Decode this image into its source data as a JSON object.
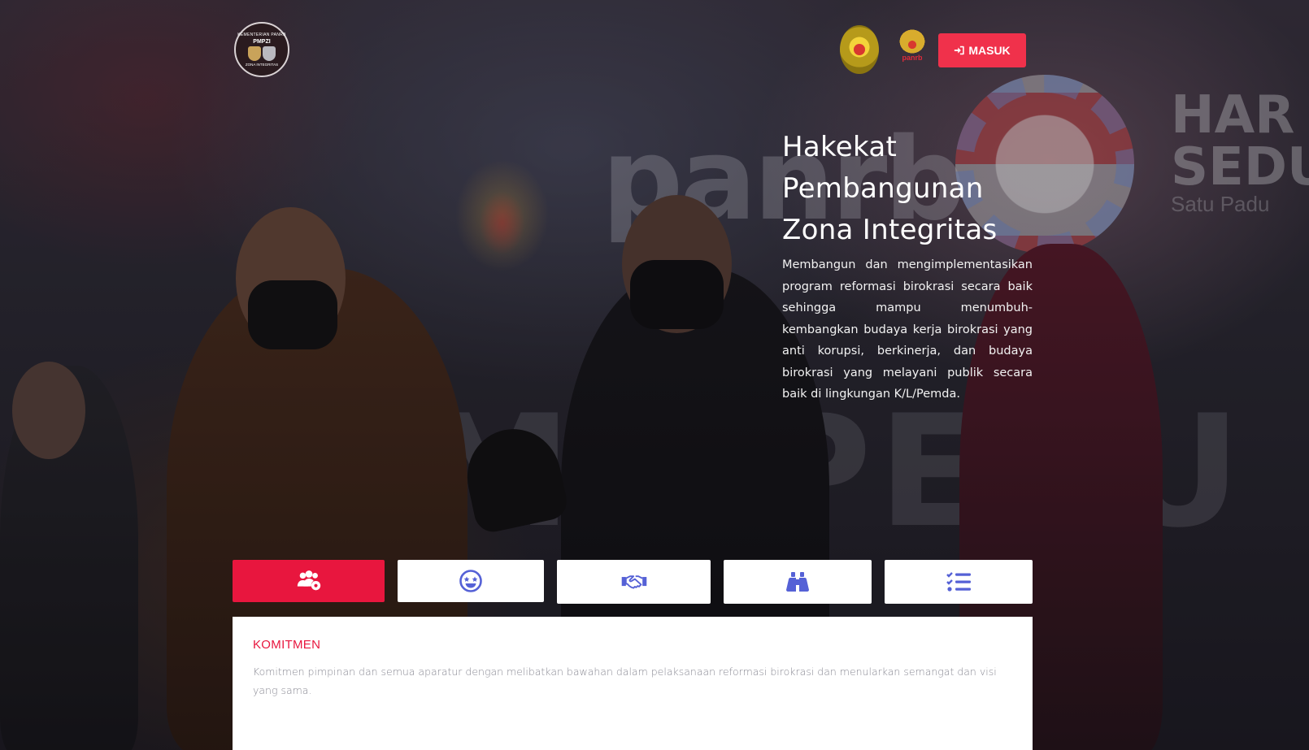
{
  "header": {
    "logo_left": {
      "top_text": "KEMENTERIAN PANRB",
      "mid_text": "PMPZI",
      "bottom_text": "ZONA INTEGRITAS"
    },
    "logo_panrb": {
      "word": "panrb"
    },
    "login_button": {
      "label": "MASUK",
      "icon": "sign-in-icon"
    }
  },
  "hero": {
    "title_line1": "Hakekat",
    "title_line2": "Pembangunan",
    "title_line3": "Zona Integritas",
    "description": "Membangun dan mengimplementasikan program reformasi birokrasi secara baik sehingga mampu menumbuh-kembangkan budaya kerja birokrasi yang anti korupsi, berkinerja, dan budaya birokrasi yang melayani publik secara baik di lingkungan K/L/Pemda."
  },
  "tabs": [
    {
      "icon": "users-cog-icon",
      "active": true
    },
    {
      "icon": "grin-stars-icon",
      "active": false
    },
    {
      "icon": "handshake-icon",
      "active": false
    },
    {
      "icon": "binoculars-icon",
      "active": false
    },
    {
      "icon": "tasks-checklist-icon",
      "active": false
    }
  ],
  "panel": {
    "title": "KOMITMEN",
    "body": "Komitmen pimpinan dan semua aparatur dengan melibatkan bawahan dalam pelaksanaan reformasi birokrasi dan menularkan semangat dan visi yang sama."
  },
  "colors": {
    "accent": "#e8163e",
    "button": "#f0314b",
    "icon_blue": "#5561d6",
    "panel_text": "#8a8a94"
  }
}
